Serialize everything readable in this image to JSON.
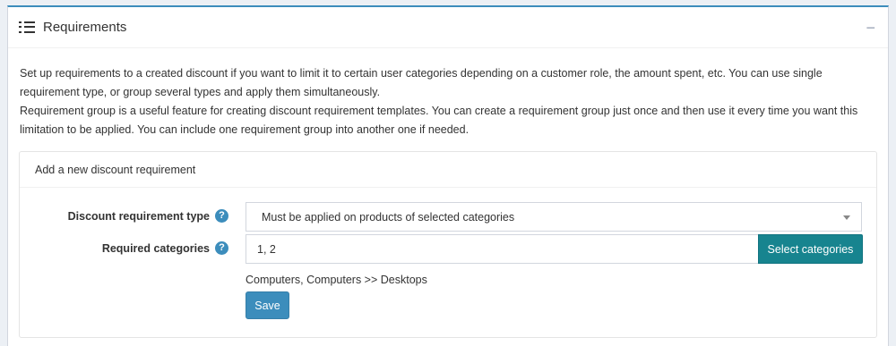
{
  "panel": {
    "title": "Requirements",
    "collapse_symbol": "−",
    "title_icon": "list-icon"
  },
  "description": {
    "paragraph1": "Set up requirements to a created discount if you want to limit it to certain user categories depending on a customer role, the amount spent, etc. You can use single requirement type, or group several types and apply them simultaneously.",
    "paragraph2": "Requirement group is a useful feature for creating discount requirement templates. You can create a requirement group just once and then use it every time you want this limitation to be applied. You can include one requirement group into another one if needed."
  },
  "new_requirement": {
    "header": "Add a new discount requirement",
    "type_label": "Discount requirement type",
    "type_value": "Must be applied on products of selected categories",
    "categories_label": "Required categories",
    "categories_value": "1, 2",
    "select_categories_button": "Select categories",
    "selected_categories_text": "Computers, Computers >> Desktops",
    "save_button": "Save",
    "help_symbol": "?"
  },
  "colors": {
    "accent": "#3c8dbc",
    "teal_button": "#17848f"
  }
}
